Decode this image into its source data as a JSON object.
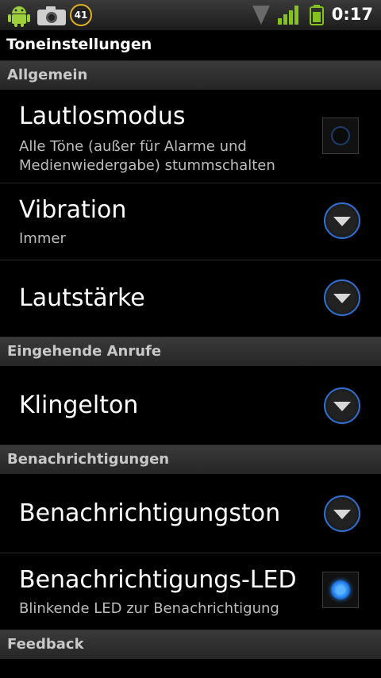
{
  "status_bar": {
    "notification_count": "41",
    "time": "0:17"
  },
  "title": "Toneinstellungen",
  "sections": {
    "general": "Allgemein",
    "incoming_calls": "Eingehende Anrufe",
    "notifications": "Benachrichtigungen",
    "feedback": "Feedback"
  },
  "items": {
    "silent_mode": {
      "title": "Lautlosmodus",
      "summary_line1": "Alle Töne (außer für Alarme und",
      "summary_line2": "Medienwiedergabe) stummschalten",
      "checked": false
    },
    "vibration": {
      "title": "Vibration",
      "summary": "Immer"
    },
    "volume": {
      "title": "Lautstärke"
    },
    "ringtone": {
      "title": "Klingelton"
    },
    "notification_sound": {
      "title": "Benachrichtigungston"
    },
    "notification_led": {
      "title": "Benachrichtigungs-LED",
      "summary": "Blinkende LED zur Benachrichtigung",
      "checked": true
    }
  },
  "colors": {
    "accent": "#2f6fd1",
    "background": "#000000",
    "section_header": "#333333"
  }
}
